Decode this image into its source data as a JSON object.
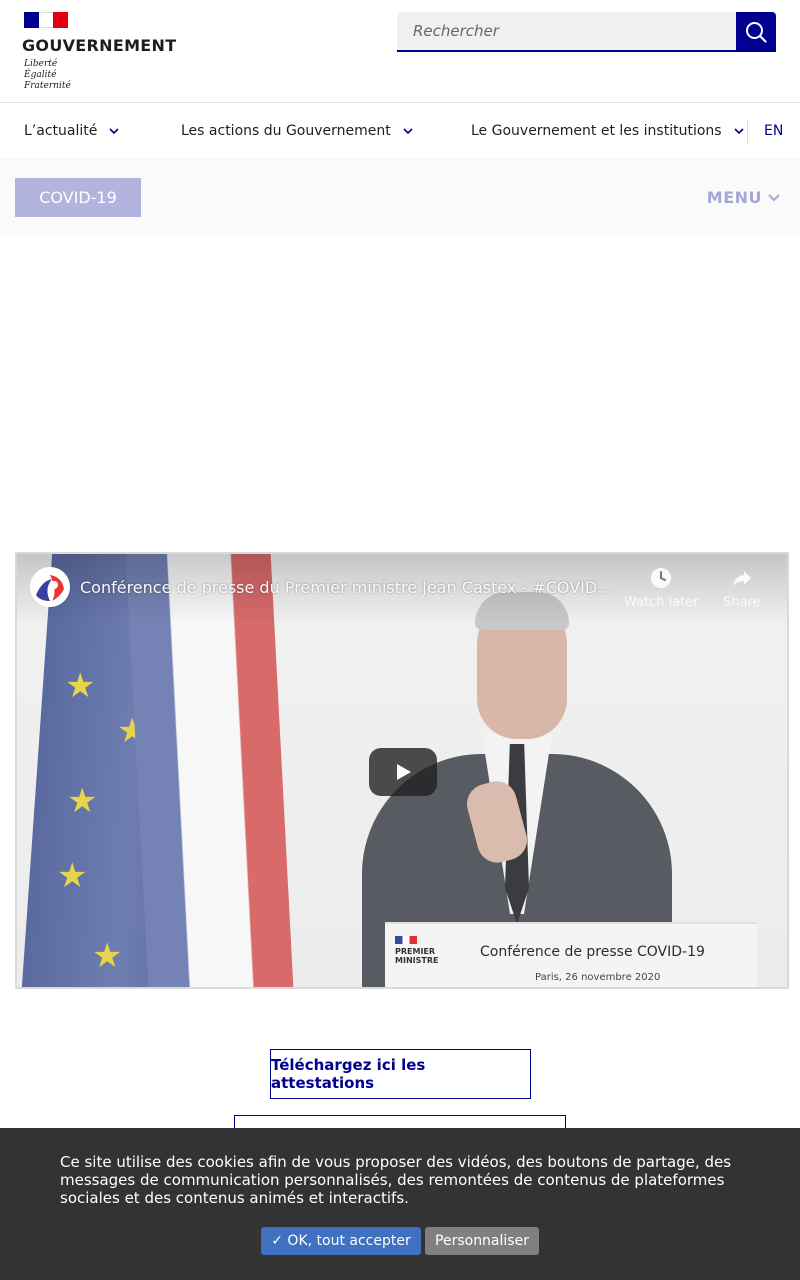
{
  "header": {
    "logo_title": "GOUVERNEMENT",
    "motto": [
      "Liberté",
      "Égalité",
      "Fraternité"
    ],
    "search_placeholder": "Rechercher"
  },
  "nav": {
    "items": [
      {
        "label": "L’actualité"
      },
      {
        "label": "Les actions du Gouvernement"
      },
      {
        "label": "Le Gouvernement et les institutions"
      }
    ],
    "lang": "EN"
  },
  "subbar": {
    "covid_label": "COVID-19",
    "menu_label": "MENU"
  },
  "video": {
    "title": "Conférence de presse du Premier ministre Jean Castex - #COVID…",
    "watch_later": "Watch later",
    "share": "Share",
    "lectern_title": "Conférence de presse COVID-19",
    "lectern_subtitle": "Paris, 26 novembre 2020",
    "lectern_logo": [
      "PREMIER",
      "MINISTRE"
    ]
  },
  "cta": {
    "download_label": "Téléchargez ici les attestations"
  },
  "cookie": {
    "text": "Ce site utilise des cookies afin de vous proposer des vidéos, des boutons de partage, des messages de communication personnalisés, des remontées de contenus de plateformes sociales et des contenus animés et interactifs.",
    "accept_label": "✓ OK, tout accepter",
    "customize_label": "Personnaliser"
  },
  "colors": {
    "brand_blue": "#000091",
    "flag_red": "#e1000f",
    "cookie_bg": "#333333",
    "accept_btn": "#4070c0"
  },
  "icons": [
    "marianne-flag-icon",
    "search-icon",
    "chevron-down-icon",
    "clock-icon",
    "share-arrow-icon",
    "play-icon"
  ]
}
